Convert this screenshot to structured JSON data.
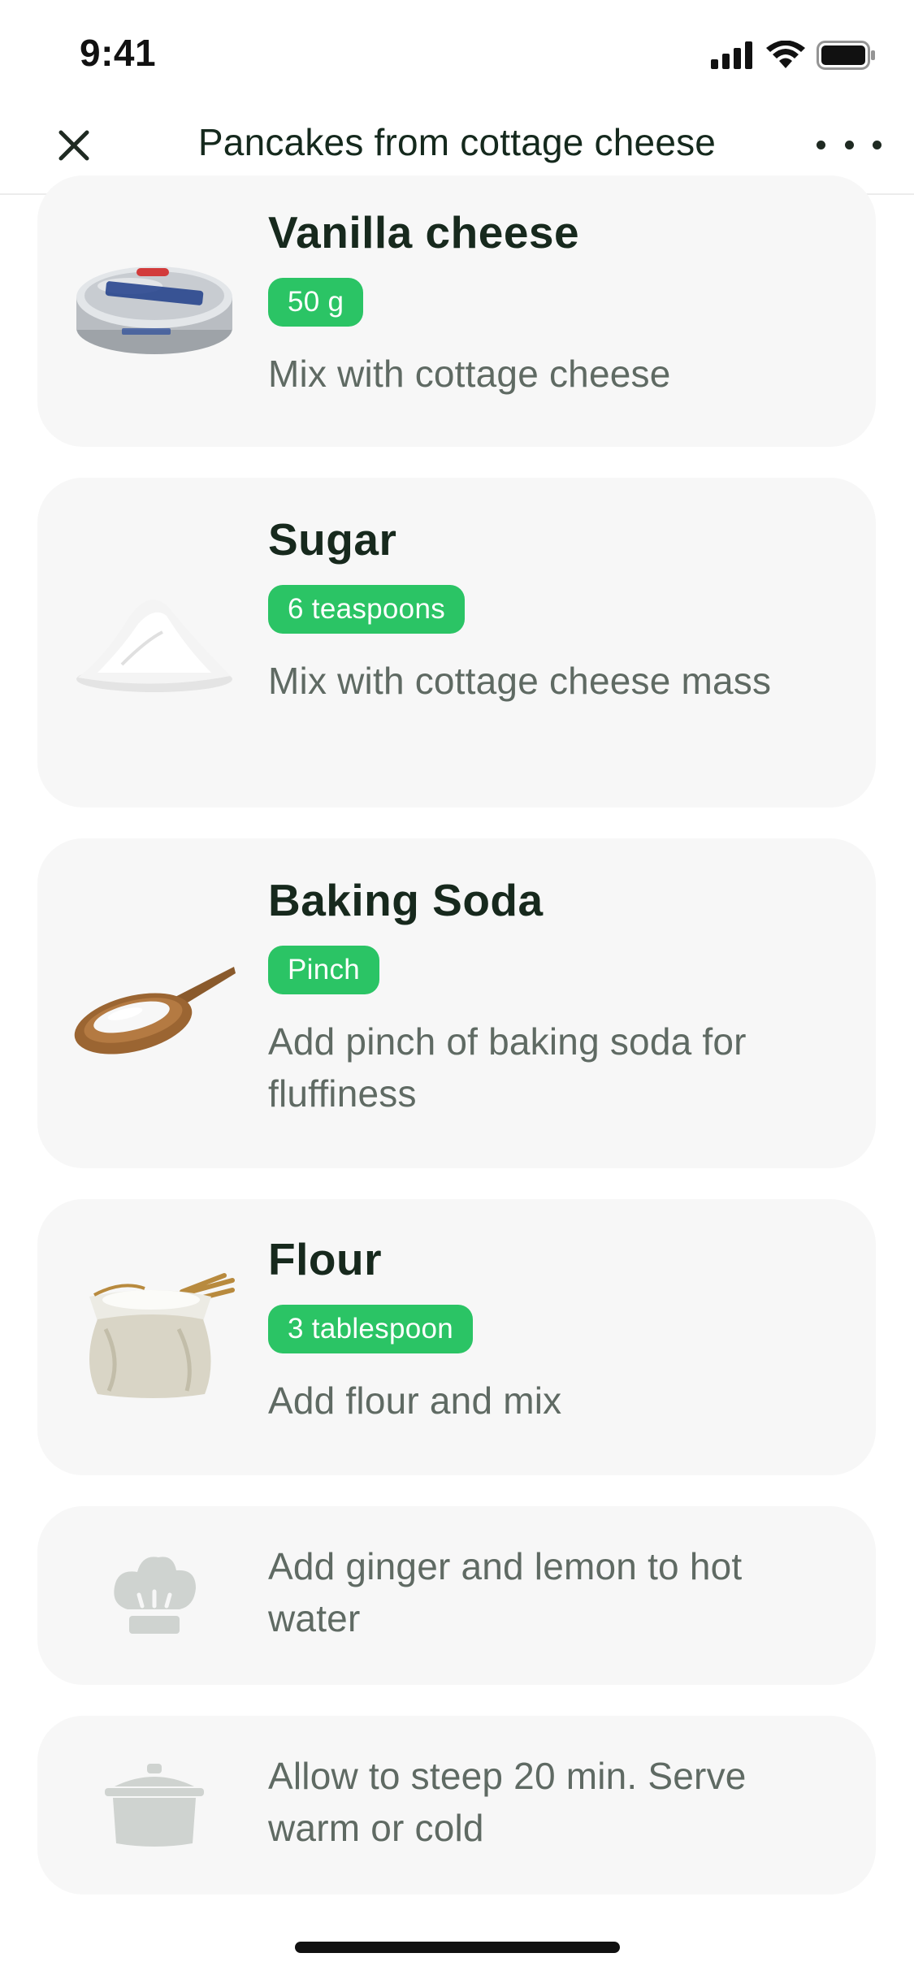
{
  "status_bar": {
    "time": "9:41"
  },
  "nav": {
    "title": "Pancakes from cottage cheese"
  },
  "ingredients": [
    {
      "name": "Vanilla cheese",
      "amount": "50 g",
      "note": "Mix with cottage cheese",
      "icon": "cream-cheese-tub-icon"
    },
    {
      "name": "Sugar",
      "amount": "6 teaspoons",
      "note": "Mix with cottage cheese mass",
      "icon": "sugar-pile-icon"
    },
    {
      "name": "Baking Soda",
      "amount": "Pinch",
      "note": "Add pinch of baking soda for fluffiness",
      "icon": "wooden-spoon-icon"
    },
    {
      "name": "Flour",
      "amount": "3 tablespoon",
      "note": "Add flour and mix",
      "icon": "flour-sack-icon"
    }
  ],
  "steps": [
    {
      "text": "Add ginger and lemon to hot water",
      "icon": "chef-hat-icon"
    },
    {
      "text": "Allow to steep 20 min. Serve warm or cold",
      "icon": "cooking-pot-icon"
    }
  ],
  "colors": {
    "accent": "#2bc465",
    "card_bg": "#f7f7f7",
    "title": "#17291d",
    "muted": "#5f6a63",
    "step_icon": "#cfd3d0"
  }
}
